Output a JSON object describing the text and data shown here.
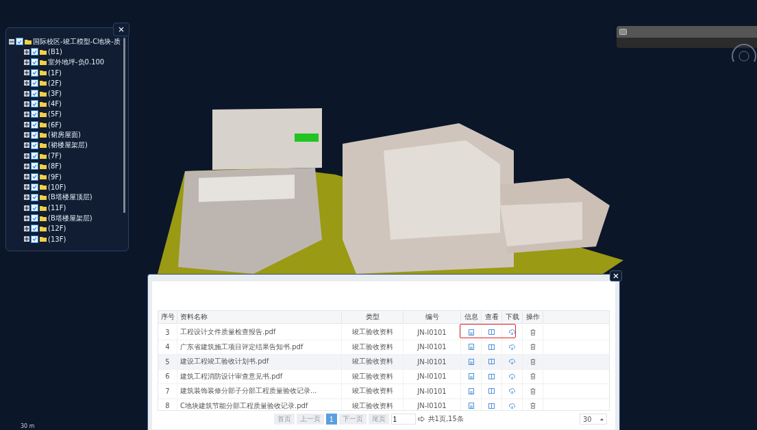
{
  "tree": {
    "label": "国际校区-竣工模型-C地块-质",
    "expanded": true,
    "checked": true,
    "children": [
      {
        "label": "(B1)",
        "expanded": false,
        "checked": true
      },
      {
        "label": "室外地坪-负0.100",
        "expanded": false,
        "checked": true
      },
      {
        "label": "(1F)",
        "expanded": false,
        "checked": true
      },
      {
        "label": "(2F)",
        "expanded": false,
        "checked": true
      },
      {
        "label": "(3F)",
        "expanded": false,
        "checked": true
      },
      {
        "label": "(4F)",
        "expanded": false,
        "checked": true
      },
      {
        "label": "(5F)",
        "expanded": false,
        "checked": true
      },
      {
        "label": "(6F)",
        "expanded": false,
        "checked": true
      },
      {
        "label": "(裙房屋面)",
        "expanded": false,
        "checked": true
      },
      {
        "label": "(裙楼屋架层)",
        "expanded": false,
        "checked": true
      },
      {
        "label": "(7F)",
        "expanded": false,
        "checked": true
      },
      {
        "label": "(8F)",
        "expanded": false,
        "checked": true
      },
      {
        "label": "(9F)",
        "expanded": false,
        "checked": true
      },
      {
        "label": "(10F)",
        "expanded": false,
        "checked": true
      },
      {
        "label": "(B塔楼屋顶层)",
        "expanded": false,
        "checked": true
      },
      {
        "label": "(11F)",
        "expanded": false,
        "checked": true
      },
      {
        "label": "(B塔楼屋架层)",
        "expanded": false,
        "checked": true
      },
      {
        "label": "(12F)",
        "expanded": false,
        "checked": true
      },
      {
        "label": "(13F)",
        "expanded": false,
        "checked": true
      }
    ]
  },
  "scale_label": "30 m",
  "table": {
    "columns": [
      "序号",
      "资料名称",
      "类型",
      "编号",
      "信息",
      "查看",
      "下载",
      "操作"
    ],
    "rows": [
      {
        "index": "3",
        "name": "工程设计文件质量检查报告.pdf",
        "type": "竣工验收资料",
        "code": "JN-I0101",
        "selected": false,
        "highlighted": true
      },
      {
        "index": "4",
        "name": "广东省建筑施工项目评定结果告知书.pdf",
        "type": "竣工验收资料",
        "code": "JN-I0101",
        "selected": false,
        "highlighted": false
      },
      {
        "index": "5",
        "name": "建设工程竣工验收计划书.pdf",
        "type": "竣工验收资料",
        "code": "JN-I0101",
        "selected": true,
        "highlighted": false
      },
      {
        "index": "6",
        "name": "建筑工程消防设计审查意见书.pdf",
        "type": "竣工验收资料",
        "code": "JN-I0101",
        "selected": false,
        "highlighted": false
      },
      {
        "index": "7",
        "name": "建筑装饰装修分部子分部工程质量验收记录...",
        "type": "竣工验收资料",
        "code": "JN-I0101",
        "selected": false,
        "highlighted": false
      },
      {
        "index": "8",
        "name": "C地块建筑节能分部工程质量验收记录.pdf",
        "type": "竣工验收资料",
        "code": "JN-I0101",
        "selected": false,
        "highlighted": false
      }
    ]
  },
  "pager": {
    "buttons": [
      {
        "label": "首页",
        "selected": false
      },
      {
        "label": "上一页",
        "selected": false
      },
      {
        "label": "1",
        "selected": true
      },
      {
        "label": "下一页",
        "selected": false
      },
      {
        "label": "尾页",
        "selected": false
      }
    ],
    "page_input": "1",
    "summary": "共1页,15条",
    "page_size": "30"
  }
}
